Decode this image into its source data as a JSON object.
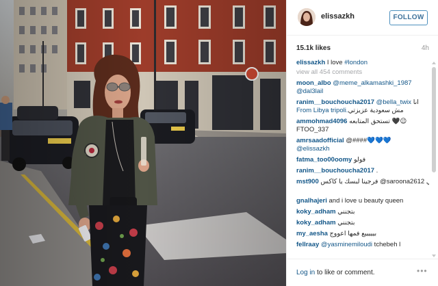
{
  "post": {
    "username": "elissazkh",
    "follow_label": "FOLLOW",
    "likes": "15.1k likes",
    "time_ago": "4h"
  },
  "caption": {
    "user": "elissazkh",
    "text": " I love ",
    "hashtag": "#london"
  },
  "view_all": "view all 454 comments",
  "comments": [
    {
      "user": "moon_albo",
      "mention": " @meme_alkamashki_1987",
      "text": ""
    },
    {
      "user": "",
      "mention": "@dal3lail",
      "text": ""
    },
    {
      "user": "ranim__bouchoucha2017",
      "mention": " @bella_twix",
      "text": " انا"
    },
    {
      "user": "",
      "mention": "",
      "text": "مش سعودية عزيزتي ",
      "link": "From Libya tripoli."
    },
    {
      "user": "ammohmad4096",
      "mention": "",
      "text": " تستحق المتابعه 🖤😉"
    },
    {
      "user": "",
      "mention": "",
      "text": "FTOO_337"
    },
    {
      "user": "amrsaadofficial",
      "mention": "",
      "text": " @####💙💙💙"
    },
    {
      "user": "",
      "mention": "@elissazkh",
      "text": ""
    },
    {
      "user": "fatma_too00oomy",
      "mention": "",
      "text": " فولو"
    },
    {
      "user": "ranim__bouchoucha2017",
      "mention": "",
      "text": " ."
    },
    {
      "user": "mst900",
      "mention": "",
      "text": " فرجينا لبسك يا كاكس @saroona2612 انتي"
    },
    {
      "user": "",
      "mention": "",
      "text": ""
    },
    {
      "user": "gnalhajeri",
      "mention": "",
      "text": " and i love u beauty queen"
    },
    {
      "user": "koky_adham",
      "mention": "",
      "text": " بتجنني"
    },
    {
      "user": "koky_adham",
      "mention": "",
      "text": " بتجنني"
    },
    {
      "user": "my_aesha",
      "mention": "",
      "text": " بيييييع فمها اعووج"
    },
    {
      "user": "fellraay",
      "mention": " @yasminemiloudi",
      "text": " tchebeh l"
    }
  ],
  "footer": {
    "login_link": "Log in",
    "login_rest": " to like or comment.",
    "more": "•••"
  },
  "icons": {
    "more": "more-options-icon",
    "scroll_up": "scroll-up-arrow-icon",
    "scroll_down": "scroll-down-arrow-icon"
  },
  "colors": {
    "link_blue": "#125688",
    "follow_border": "#4c8fbd",
    "brick_red": "#a8412c"
  }
}
